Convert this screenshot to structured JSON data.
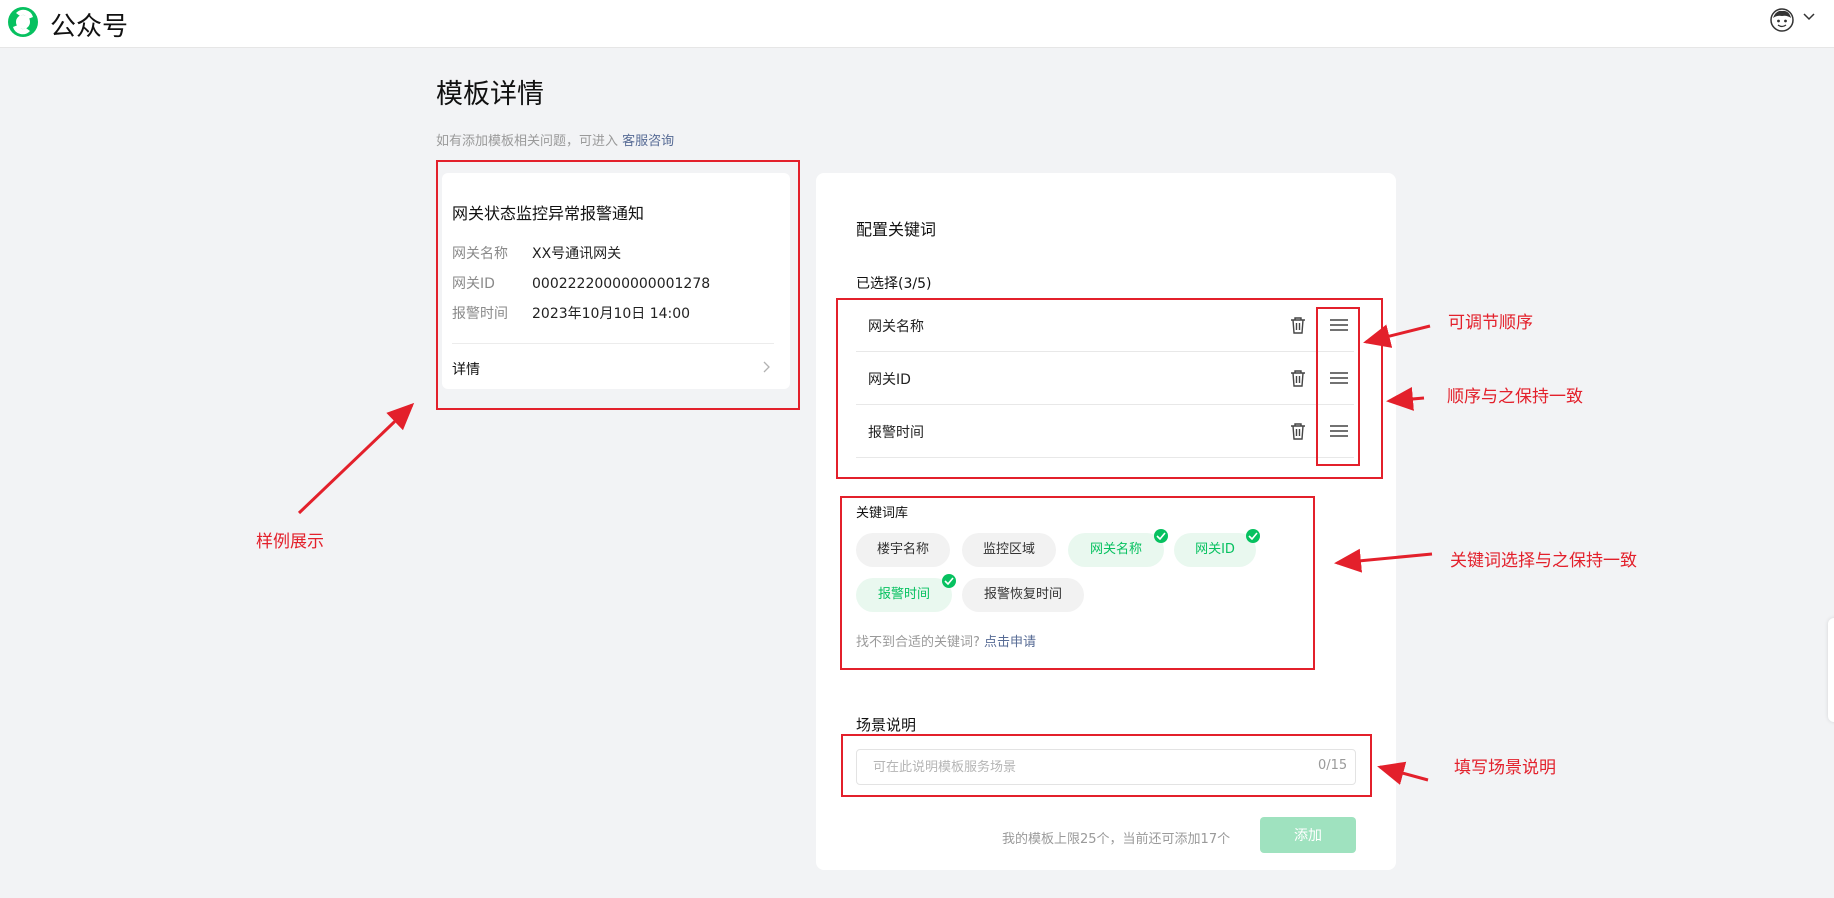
{
  "app": {
    "brand": "公众号",
    "brand_color": "#07c160",
    "logo_icon": "wechat-official-account-logo-icon",
    "avatar_icon": "user-avatar-icon",
    "menu_icon": "chevron-down-icon"
  },
  "page": {
    "title": "模板详情",
    "help_text": "如有添加模板相关问题，可进入",
    "help_link": "客服咨询"
  },
  "example": {
    "title": "网关状态监控异常报警通知",
    "rows": [
      {
        "key": "网关名称",
        "value": "XX号通讯网关"
      },
      {
        "key": "网关ID",
        "value": "00022220000000001278"
      },
      {
        "key": "报警时间",
        "value": "2023年10月10日 14:00"
      }
    ],
    "detail_label": "详情"
  },
  "config": {
    "title": "配置关键词",
    "selected_label": "已选择(3/5)",
    "selected": [
      "网关名称",
      "网关ID",
      "报警时间"
    ],
    "library_label": "关键词库",
    "library": [
      {
        "label": "楼宇名称",
        "selected": false
      },
      {
        "label": "监控区域",
        "selected": false
      },
      {
        "label": "网关名称",
        "selected": true
      },
      {
        "label": "网关ID",
        "selected": true
      },
      {
        "label": "报警时间",
        "selected": true
      },
      {
        "label": "报警恢复时间",
        "selected": false
      }
    ],
    "not_found_text": "找不到合适的关键词?",
    "apply_link": "点击申请",
    "scene_label": "场景说明",
    "scene_placeholder": "可在此说明模板服务场景",
    "scene_value": "",
    "scene_count": "0/15",
    "limit_text": "我的模板上限25个，当前还可添加17个",
    "add_label": "添加"
  },
  "annotations": {
    "color": "#e3202b",
    "example": "样例展示",
    "adjust_order": "可调节顺序",
    "order_consistent": "顺序与之保持一致",
    "keyword_consistent": "关键词选择与之保持一致",
    "fill_scene": "填写场景说明"
  }
}
